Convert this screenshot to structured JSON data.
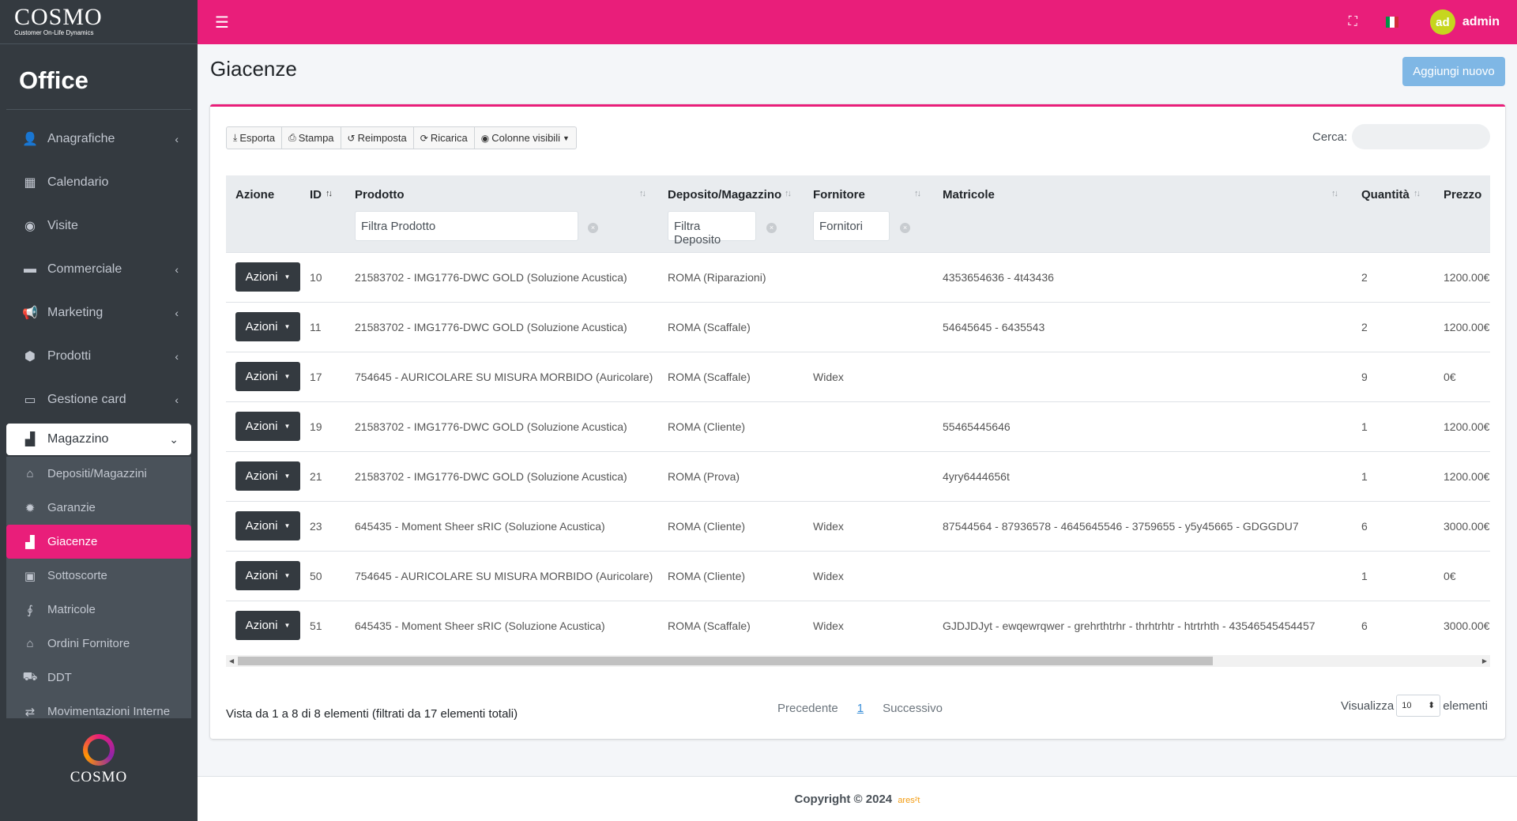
{
  "brand": {
    "logo": "COSMO",
    "tagline": "Customer On-Life Dynamics",
    "section": "Office",
    "footer_logo": "COSMO"
  },
  "sidebar": {
    "items": [
      {
        "label": "Anagrafiche",
        "icon": "user-plus-icon",
        "glyph": "👤",
        "chevron": true
      },
      {
        "label": "Calendario",
        "icon": "calendar-icon",
        "glyph": "▦",
        "chevron": false
      },
      {
        "label": "Visite",
        "icon": "eye-icon",
        "glyph": "◉",
        "chevron": false
      },
      {
        "label": "Commerciale",
        "icon": "card-icon",
        "glyph": "▬",
        "chevron": true
      },
      {
        "label": "Marketing",
        "icon": "megaphone-icon",
        "glyph": "📢",
        "chevron": true
      },
      {
        "label": "Prodotti",
        "icon": "box-icon",
        "glyph": "⬢",
        "chevron": true
      },
      {
        "label": "Gestione card",
        "icon": "credit-card-icon",
        "glyph": "▭",
        "chevron": true
      }
    ],
    "open_item": {
      "label": "Magazzino",
      "icon": "warehouse-icon",
      "glyph": "▟"
    },
    "sub_items": [
      {
        "label": "Depositi/Magazzini",
        "icon": "warehouse-icon",
        "glyph": "⌂",
        "active": false
      },
      {
        "label": "Garanzie",
        "icon": "badge-icon",
        "glyph": "✹",
        "active": false
      },
      {
        "label": "Giacenze",
        "icon": "boxes-icon",
        "glyph": "▟",
        "active": true
      },
      {
        "label": "Sottoscorte",
        "icon": "box-open-icon",
        "glyph": "▣",
        "active": false
      },
      {
        "label": "Matricole",
        "icon": "hearing-icon",
        "glyph": "∮",
        "active": false
      },
      {
        "label": "Ordini Fornitore",
        "icon": "store-icon",
        "glyph": "⌂",
        "active": false
      },
      {
        "label": "DDT",
        "icon": "truck-icon",
        "glyph": "⛟",
        "active": false
      },
      {
        "label": "Movimentazioni Interne",
        "icon": "exchange-icon",
        "glyph": "⇄",
        "active": false
      }
    ]
  },
  "topbar": {
    "user_initials": "ad",
    "username": "admin",
    "flag_colors": [
      "#009246",
      "#ffffff",
      "#ce2b37"
    ]
  },
  "page": {
    "title": "Giacenze",
    "add_button": "Aggiungi nuovo"
  },
  "toolbar": {
    "buttons": [
      {
        "label": "Esporta",
        "icon": "download-icon",
        "glyph": "⤓"
      },
      {
        "label": "Stampa",
        "icon": "print-icon",
        "glyph": "⎙"
      },
      {
        "label": "Reimposta",
        "icon": "undo-icon",
        "glyph": "↺"
      },
      {
        "label": "Ricarica",
        "icon": "refresh-icon",
        "glyph": "⟳"
      },
      {
        "label": "Colonne visibili",
        "icon": "eye-icon",
        "glyph": "◉"
      }
    ],
    "search_label": "Cerca:"
  },
  "table": {
    "headers": [
      "Azione",
      "ID",
      "Prodotto",
      "Deposito/Magazzino",
      "Fornitore",
      "Matricole",
      "Quantità",
      "Prezzo"
    ],
    "filters": {
      "prodotto": "Filtra Prodotto",
      "deposito": "Filtra Deposito",
      "fornitore": "Fornitori"
    },
    "action_label": "Azioni",
    "rows": [
      {
        "id": "10",
        "prodotto": "21583702 - IMG1776-DWC GOLD (Soluzione Acustica)",
        "deposito": "ROMA (Riparazioni)",
        "fornitore": "",
        "matricole": "4353654636 - 4t43436",
        "quantita": "2",
        "prezzo": "1200.00€"
      },
      {
        "id": "11",
        "prodotto": "21583702 - IMG1776-DWC GOLD (Soluzione Acustica)",
        "deposito": "ROMA (Scaffale)",
        "fornitore": "",
        "matricole": "54645645 - 6435543",
        "quantita": "2",
        "prezzo": "1200.00€"
      },
      {
        "id": "17",
        "prodotto": "754645 - AURICOLARE SU MISURA MORBIDO (Auricolare)",
        "deposito": "ROMA (Scaffale)",
        "fornitore": "Widex",
        "matricole": "",
        "quantita": "9",
        "prezzo": "0€"
      },
      {
        "id": "19",
        "prodotto": "21583702 - IMG1776-DWC GOLD (Soluzione Acustica)",
        "deposito": "ROMA (Cliente)",
        "fornitore": "",
        "matricole": "55465445646",
        "quantita": "1",
        "prezzo": "1200.00€"
      },
      {
        "id": "21",
        "prodotto": "21583702 - IMG1776-DWC GOLD (Soluzione Acustica)",
        "deposito": "ROMA (Prova)",
        "fornitore": "",
        "matricole": "4yry6444656t",
        "quantita": "1",
        "prezzo": "1200.00€"
      },
      {
        "id": "23",
        "prodotto": "645435 - Moment Sheer sRIC (Soluzione Acustica)",
        "deposito": "ROMA (Cliente)",
        "fornitore": "Widex",
        "matricole": "87544564 - 87936578 - 4645645546 - 3759655 - y5y45665 - GDGGDU7",
        "quantita": "6",
        "prezzo": "3000.00€"
      },
      {
        "id": "50",
        "prodotto": "754645 - AURICOLARE SU MISURA MORBIDO (Auricolare)",
        "deposito": "ROMA (Cliente)",
        "fornitore": "Widex",
        "matricole": "",
        "quantita": "1",
        "prezzo": "0€"
      },
      {
        "id": "51",
        "prodotto": "645435 - Moment Sheer sRIC (Soluzione Acustica)",
        "deposito": "ROMA (Scaffale)",
        "fornitore": "Widex",
        "matricole": "GJDJDJyt - ewqewrqwer - grehrthtrhr - thrhtrhtr - htrtrhth - 43546545454457",
        "quantita": "6",
        "prezzo": "3000.00€"
      }
    ]
  },
  "pagination": {
    "info": "Vista da 1 a 8 di 8 elementi (filtrati da 17 elementi totali)",
    "prev": "Precedente",
    "page": "1",
    "next": "Successivo",
    "show_label": "Visualizza",
    "page_size": "10",
    "elements_label": "elementi"
  },
  "footer": {
    "copyright": "Copyright © 2024",
    "brand": "ares²t"
  },
  "colors": {
    "accent": "#e91e7a",
    "sidebar": "#343a40",
    "add_button": "#7fb7e5"
  }
}
